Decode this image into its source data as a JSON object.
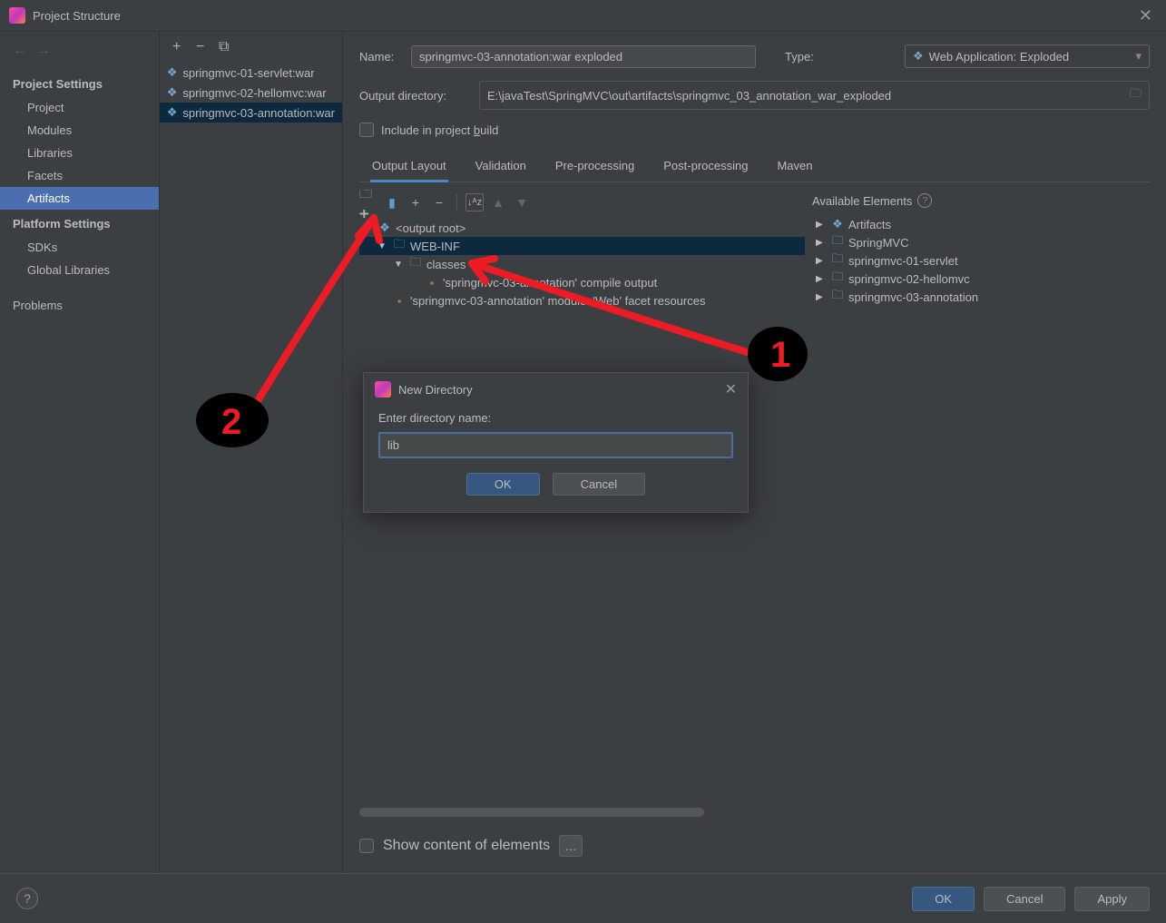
{
  "window": {
    "title": "Project Structure"
  },
  "sidebar": {
    "section1": "Project Settings",
    "items1": [
      "Project",
      "Modules",
      "Libraries",
      "Facets",
      "Artifacts"
    ],
    "section2": "Platform Settings",
    "items2": [
      "SDKs",
      "Global Libraries"
    ],
    "problems": "Problems"
  },
  "artifacts": {
    "list": [
      "springmvc-01-servlet:war",
      "springmvc-02-hellomvc:war",
      "springmvc-03-annotation:war"
    ]
  },
  "form": {
    "name_label": "Name:",
    "name_value": "springmvc-03-annotation:war exploded",
    "type_label": "Type:",
    "type_value": "Web Application: Exploded",
    "output_label": "Output directory:",
    "output_value": "E:\\javaTest\\SpringMVC\\out\\artifacts\\springmvc_03_annotation_war_exploded",
    "include_label_pre": "Include in project ",
    "include_label_u": "b",
    "include_label_post": "uild"
  },
  "tabs": [
    "Output Layout",
    "Validation",
    "Pre-processing",
    "Post-processing",
    "Maven"
  ],
  "tree": {
    "root": "<output root>",
    "webinf": "WEB-INF",
    "classes": "classes",
    "compile_output": "'springmvc-03-annotation' compile output",
    "facet_resources": "'springmvc-03-annotation' module: 'Web' facet resources"
  },
  "available": {
    "header": "Available Elements",
    "items": [
      "Artifacts",
      "SpringMVC",
      "springmvc-01-servlet",
      "springmvc-02-hellomvc",
      "springmvc-03-annotation"
    ]
  },
  "show_content": "Show content of elements",
  "modal": {
    "title": "New Directory",
    "prompt": "Enter directory name:",
    "value": "lib",
    "ok": "OK",
    "cancel": "Cancel"
  },
  "footer": {
    "ok": "OK",
    "cancel": "Cancel",
    "apply": "Apply"
  },
  "annotations": {
    "num1": "1",
    "num2": "2"
  }
}
